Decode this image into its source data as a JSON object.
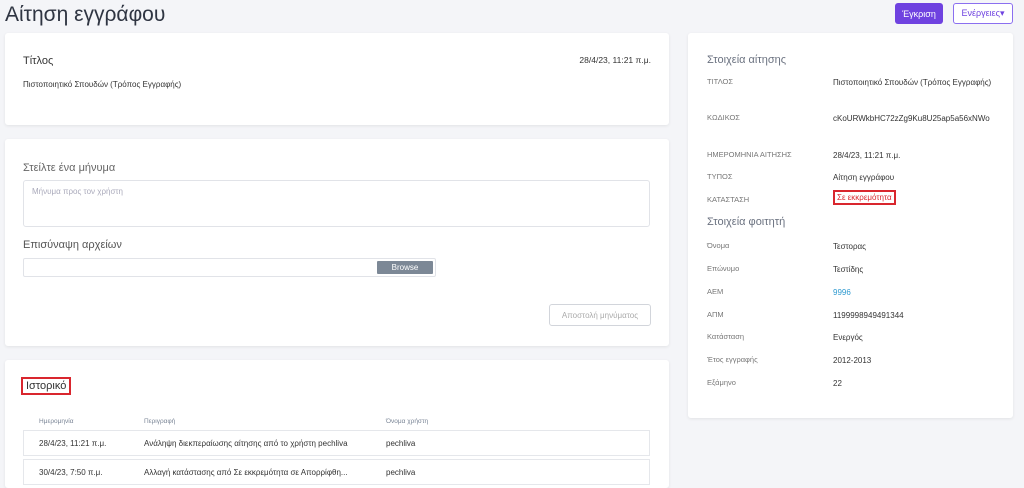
{
  "header": {
    "title": "Αίτηση εγγράφου",
    "approve_label": "Έγκριση",
    "actions_label": "Ενέργειες",
    "actions_caret": "▾"
  },
  "title_card": {
    "label": "Τίτλος",
    "date": "28/4/23, 11:21 π.μ.",
    "value": "Πιστοποιητικό Σπουδών (Τρόπος Εγγραφής)"
  },
  "message_card": {
    "heading": "Στείλτε ένα μήνυμα",
    "placeholder": "Μήνυμα προς τον χρήστη",
    "attach_label": "Επισύναψη αρχείων",
    "browse_label": "Browse",
    "send_label": "Αποστολή μηνύματος"
  },
  "history": {
    "heading": "Ιστορικό",
    "columns": [
      "Ημερομηνία",
      "Περιγραφή",
      "Όνομα χρήστη"
    ],
    "rows": [
      {
        "date": "28/4/23, 11:21 π.μ.",
        "description": "Ανάληψη διεκπεραίωσης αίτησης από το χρήστη pechliva",
        "user": "pechliva"
      },
      {
        "date": "30/4/23, 7:50 π.μ.",
        "description": "Αλλαγή κατάστασης από Σε εκκρεμότητα σε Απορρίφθη...",
        "user": "pechliva"
      }
    ]
  },
  "request_info": {
    "heading": "Στοιχεία αίτησης",
    "title_key": "ΤΙΤΛΟΣ",
    "title_value": "Πιστοποιητικό Σπουδών (Τρόπος Εγγραφής)",
    "code_key": "ΚΩΔΙΚΟΣ",
    "code_value": "cKoURWkbHC72zZg9Ku8U25ap5a56xNWo",
    "date_key": "ΗΜΕΡΟΜΗΝΙΑ ΑΙΤΗΣΗΣ",
    "date_value": "28/4/23, 11:21 π.μ.",
    "type_key": "ΤΥΠΟΣ",
    "type_value": "Αίτηση εγγράφου",
    "status_key": "ΚΑΤΑΣΤΑΣΗ",
    "status_value": "Σε εκκρεμότητα"
  },
  "student_info": {
    "heading": "Στοιχεία φοιτητή",
    "first_name_key": "Όνομα",
    "first_name_value": "Τεστορας",
    "last_name_key": "Επώνυμο",
    "last_name_value": "Τεστίδης",
    "aem_key": "ΑΕΜ",
    "aem_value": "9996",
    "apm_key": "ΑΠΜ",
    "apm_value": "1199998949491344",
    "status_key": "Κατάσταση",
    "status_value": "Ενεργός",
    "year_key": "Έτος εγγραφής",
    "year_value": "2012-2013",
    "semester_key": "Εξάμηνο",
    "semester_value": "22"
  },
  "colors": {
    "accent": "#6f42e0",
    "highlight": "#d9262e",
    "link": "#2f9ad0"
  }
}
